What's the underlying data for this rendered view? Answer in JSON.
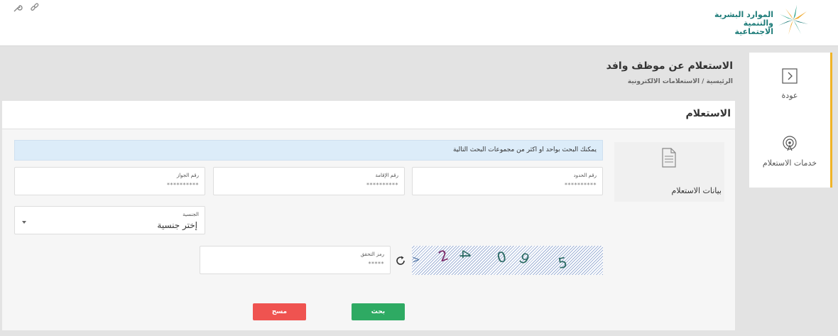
{
  "header": {
    "logo_line1": "الموارد البشرية",
    "logo_line2": "والتنمية الاجتماعية",
    "icons": [
      "wrench-icon",
      "link-icon"
    ]
  },
  "sidebar": {
    "items": [
      {
        "label": "عودة",
        "icon": "back-arrow-icon"
      },
      {
        "label": "خدمات الاستعلام",
        "icon": "broadcast-icon"
      }
    ],
    "accent_color": "#f0b428"
  },
  "page": {
    "title": "الاستعلام عن موظف وافد",
    "breadcrumb": "الرئيسية / الاستعلامات الالكترونية"
  },
  "card": {
    "title": "الاستعلام",
    "info_label": "بيانات الاستعلام",
    "alert": "يمكنك البحث بواحد او اكثر من مجموعات البحث التالية",
    "fields": {
      "border_number": {
        "label": "رقم الحدود",
        "value": "**********"
      },
      "iqama_number": {
        "label": "رقم الإقامة",
        "value": "**********"
      },
      "passport_number": {
        "label": "رقم الجواز",
        "value": "**********"
      },
      "nationality": {
        "label": "الجنسية",
        "value": "إختر جنسية"
      },
      "captcha_code": {
        "label": "رمز التحقق",
        "value": "*****"
      }
    },
    "captcha_text": "24095",
    "buttons": {
      "search": "بحث",
      "clear": "مسح"
    },
    "colors": {
      "search": "#2eaa63",
      "clear": "#ef5350",
      "alert_bg": "#dcecf9"
    }
  }
}
